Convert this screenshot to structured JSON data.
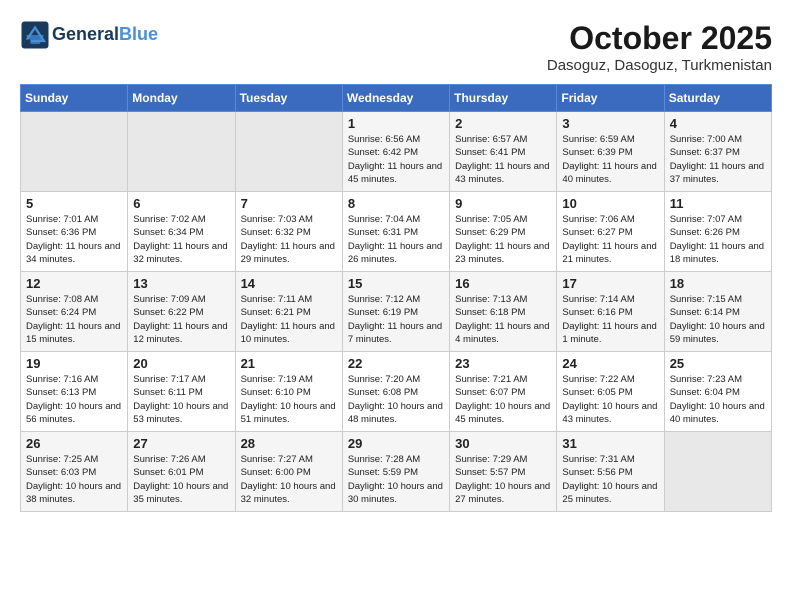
{
  "header": {
    "logo_line1": "General",
    "logo_line2": "Blue",
    "month": "October 2025",
    "location": "Dasoguz, Dasoguz, Turkmenistan"
  },
  "weekdays": [
    "Sunday",
    "Monday",
    "Tuesday",
    "Wednesday",
    "Thursday",
    "Friday",
    "Saturday"
  ],
  "weeks": [
    [
      {
        "day": "",
        "content": ""
      },
      {
        "day": "",
        "content": ""
      },
      {
        "day": "",
        "content": ""
      },
      {
        "day": "1",
        "content": "Sunrise: 6:56 AM\nSunset: 6:42 PM\nDaylight: 11 hours\nand 45 minutes."
      },
      {
        "day": "2",
        "content": "Sunrise: 6:57 AM\nSunset: 6:41 PM\nDaylight: 11 hours\nand 43 minutes."
      },
      {
        "day": "3",
        "content": "Sunrise: 6:59 AM\nSunset: 6:39 PM\nDaylight: 11 hours\nand 40 minutes."
      },
      {
        "day": "4",
        "content": "Sunrise: 7:00 AM\nSunset: 6:37 PM\nDaylight: 11 hours\nand 37 minutes."
      }
    ],
    [
      {
        "day": "5",
        "content": "Sunrise: 7:01 AM\nSunset: 6:36 PM\nDaylight: 11 hours\nand 34 minutes."
      },
      {
        "day": "6",
        "content": "Sunrise: 7:02 AM\nSunset: 6:34 PM\nDaylight: 11 hours\nand 32 minutes."
      },
      {
        "day": "7",
        "content": "Sunrise: 7:03 AM\nSunset: 6:32 PM\nDaylight: 11 hours\nand 29 minutes."
      },
      {
        "day": "8",
        "content": "Sunrise: 7:04 AM\nSunset: 6:31 PM\nDaylight: 11 hours\nand 26 minutes."
      },
      {
        "day": "9",
        "content": "Sunrise: 7:05 AM\nSunset: 6:29 PM\nDaylight: 11 hours\nand 23 minutes."
      },
      {
        "day": "10",
        "content": "Sunrise: 7:06 AM\nSunset: 6:27 PM\nDaylight: 11 hours\nand 21 minutes."
      },
      {
        "day": "11",
        "content": "Sunrise: 7:07 AM\nSunset: 6:26 PM\nDaylight: 11 hours\nand 18 minutes."
      }
    ],
    [
      {
        "day": "12",
        "content": "Sunrise: 7:08 AM\nSunset: 6:24 PM\nDaylight: 11 hours\nand 15 minutes."
      },
      {
        "day": "13",
        "content": "Sunrise: 7:09 AM\nSunset: 6:22 PM\nDaylight: 11 hours\nand 12 minutes."
      },
      {
        "day": "14",
        "content": "Sunrise: 7:11 AM\nSunset: 6:21 PM\nDaylight: 11 hours\nand 10 minutes."
      },
      {
        "day": "15",
        "content": "Sunrise: 7:12 AM\nSunset: 6:19 PM\nDaylight: 11 hours\nand 7 minutes."
      },
      {
        "day": "16",
        "content": "Sunrise: 7:13 AM\nSunset: 6:18 PM\nDaylight: 11 hours\nand 4 minutes."
      },
      {
        "day": "17",
        "content": "Sunrise: 7:14 AM\nSunset: 6:16 PM\nDaylight: 11 hours\nand 1 minute."
      },
      {
        "day": "18",
        "content": "Sunrise: 7:15 AM\nSunset: 6:14 PM\nDaylight: 10 hours\nand 59 minutes."
      }
    ],
    [
      {
        "day": "19",
        "content": "Sunrise: 7:16 AM\nSunset: 6:13 PM\nDaylight: 10 hours\nand 56 minutes."
      },
      {
        "day": "20",
        "content": "Sunrise: 7:17 AM\nSunset: 6:11 PM\nDaylight: 10 hours\nand 53 minutes."
      },
      {
        "day": "21",
        "content": "Sunrise: 7:19 AM\nSunset: 6:10 PM\nDaylight: 10 hours\nand 51 minutes."
      },
      {
        "day": "22",
        "content": "Sunrise: 7:20 AM\nSunset: 6:08 PM\nDaylight: 10 hours\nand 48 minutes."
      },
      {
        "day": "23",
        "content": "Sunrise: 7:21 AM\nSunset: 6:07 PM\nDaylight: 10 hours\nand 45 minutes."
      },
      {
        "day": "24",
        "content": "Sunrise: 7:22 AM\nSunset: 6:05 PM\nDaylight: 10 hours\nand 43 minutes."
      },
      {
        "day": "25",
        "content": "Sunrise: 7:23 AM\nSunset: 6:04 PM\nDaylight: 10 hours\nand 40 minutes."
      }
    ],
    [
      {
        "day": "26",
        "content": "Sunrise: 7:25 AM\nSunset: 6:03 PM\nDaylight: 10 hours\nand 38 minutes."
      },
      {
        "day": "27",
        "content": "Sunrise: 7:26 AM\nSunset: 6:01 PM\nDaylight: 10 hours\nand 35 minutes."
      },
      {
        "day": "28",
        "content": "Sunrise: 7:27 AM\nSunset: 6:00 PM\nDaylight: 10 hours\nand 32 minutes."
      },
      {
        "day": "29",
        "content": "Sunrise: 7:28 AM\nSunset: 5:59 PM\nDaylight: 10 hours\nand 30 minutes."
      },
      {
        "day": "30",
        "content": "Sunrise: 7:29 AM\nSunset: 5:57 PM\nDaylight: 10 hours\nand 27 minutes."
      },
      {
        "day": "31",
        "content": "Sunrise: 7:31 AM\nSunset: 5:56 PM\nDaylight: 10 hours\nand 25 minutes."
      },
      {
        "day": "",
        "content": ""
      }
    ]
  ]
}
